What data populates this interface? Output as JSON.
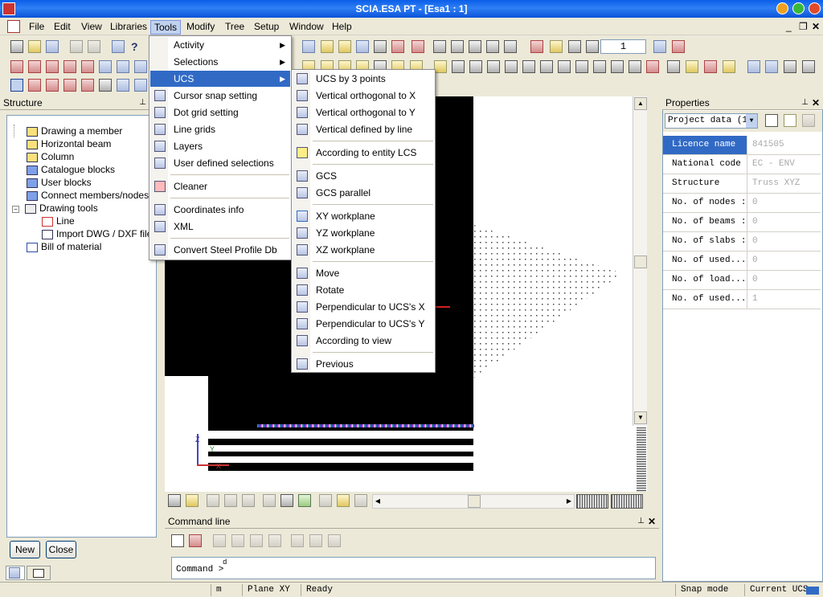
{
  "app": {
    "title": "SCIA.ESA PT - [Esa1 : 1]"
  },
  "menubar": {
    "items": [
      "File",
      "Edit",
      "View",
      "Libraries",
      "Tools",
      "Modify",
      "Tree",
      "Setup",
      "Window",
      "Help"
    ],
    "active": "Tools"
  },
  "toolbar": {
    "zoom_value": "1"
  },
  "structure_panel": {
    "title": "Structure",
    "items": [
      "Drawing a member",
      "Horizontal beam",
      "Column",
      "Catalogue blocks",
      "User blocks",
      "Connect members/nodes",
      "Drawing tools",
      "Line",
      "Import DWG / DXF file",
      "Bill of material"
    ],
    "new_button": "New",
    "close_button": "Close"
  },
  "tools_menu": {
    "items": [
      "Activity",
      "Selections",
      "UCS",
      "Cursor snap setting",
      "Dot grid setting",
      "Line grids",
      "Layers",
      "User defined selections",
      "Cleaner",
      "Coordinates info",
      "XML",
      "Convert Steel Profile Db"
    ],
    "highlighted": "UCS"
  },
  "ucs_submenu": {
    "items": [
      "UCS by 3 points",
      "Vertical orthogonal to X",
      "Vertical orthogonal to Y",
      "Vertical defined by line",
      "According to entity LCS",
      "GCS",
      "GCS parallel",
      "XY workplane",
      "YZ workplane",
      "XZ workplane",
      "Move",
      "Rotate",
      "Perpendicular to UCS's X",
      "Perpendicular to UCS's Y",
      "According to view",
      "Previous"
    ]
  },
  "properties_panel": {
    "title": "Properties",
    "selector": "Project data (1)",
    "rows": [
      {
        "label": "Licence name",
        "value": "841505"
      },
      {
        "label": "National code",
        "value": "EC - ENV"
      },
      {
        "label": "Structure",
        "value": "Truss XYZ"
      },
      {
        "label": "No. of nodes :",
        "value": "0"
      },
      {
        "label": "No. of beams :",
        "value": "0"
      },
      {
        "label": "No. of slabs :",
        "value": "0"
      },
      {
        "label": "No. of used...",
        "value": "0"
      },
      {
        "label": "No. of load...",
        "value": "0"
      },
      {
        "label": "No. of used...",
        "value": "1"
      }
    ]
  },
  "command_line": {
    "title": "Command line",
    "prompt": "Command >",
    "superscript": "d"
  },
  "statusbar": {
    "unit": "m",
    "plane": "Plane XY",
    "status": "Ready",
    "snap": "Snap mode",
    "ucs": "Current UCS"
  },
  "colors": {
    "accent": "#316ac5",
    "title": "#0a5ee8"
  }
}
